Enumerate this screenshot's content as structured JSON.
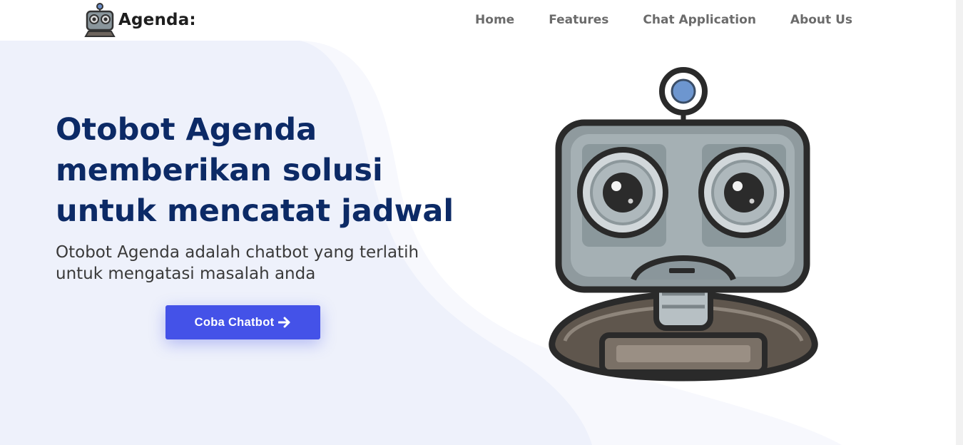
{
  "nav": {
    "brand": "Agenda:",
    "items": [
      {
        "label": "Home"
      },
      {
        "label": "Features"
      },
      {
        "label": "Chat Application"
      },
      {
        "label": "About Us"
      }
    ]
  },
  "hero": {
    "title": "Otobot Agenda memberikan solusi untuk mencatat jadwal",
    "subtitle": "Otobot Agenda adalah chatbot yang terlatih untuk mengatasi masalah anda",
    "cta_label": "Coba Chatbot",
    "cta_icon": "arrow-right-icon",
    "illustration": "robot-illustration"
  },
  "colors": {
    "accent": "#4452e8",
    "title": "#0c2a66",
    "background_wave": "#eef1fb"
  }
}
